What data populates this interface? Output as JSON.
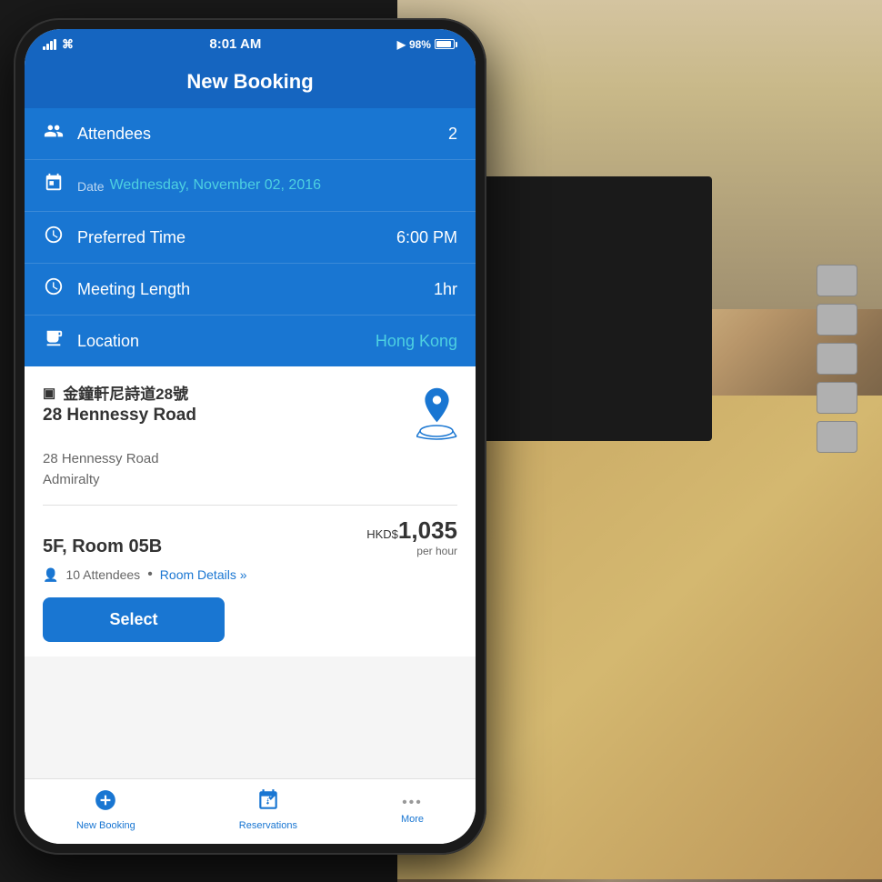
{
  "status_bar": {
    "signal": "signal",
    "wifi": "wifi",
    "time": "8:01 AM",
    "location_arrow": "➤",
    "battery_pct": "98%"
  },
  "header": {
    "title": "New Booking"
  },
  "form": {
    "attendees_label": "Attendees",
    "attendees_value": "2",
    "date_prefix": "Date",
    "date_value": "Wednesday, November 02, 2016",
    "preferred_time_label": "Preferred Time",
    "preferred_time_value": "6:00 PM",
    "meeting_length_label": "Meeting Length",
    "meeting_length_value": "1hr",
    "location_label": "Location",
    "location_value": "Hong Kong"
  },
  "room_card": {
    "chinese_name": "金鐘軒尼詩道28號",
    "english_name": "28 Hennessy Road",
    "address_line1": "28 Hennessy Road",
    "address_line2": "Admiralty",
    "room_number": "5F, Room 05B",
    "price_currency": "HKD$",
    "price_amount": "1,035",
    "price_unit": "per hour",
    "attendees_count": "10 Attendees",
    "room_details_link": "Room Details »",
    "select_button": "Select"
  },
  "bottom_nav": {
    "new_booking_label": "New Booking",
    "reservations_label": "Reservations",
    "more_label": "More"
  }
}
